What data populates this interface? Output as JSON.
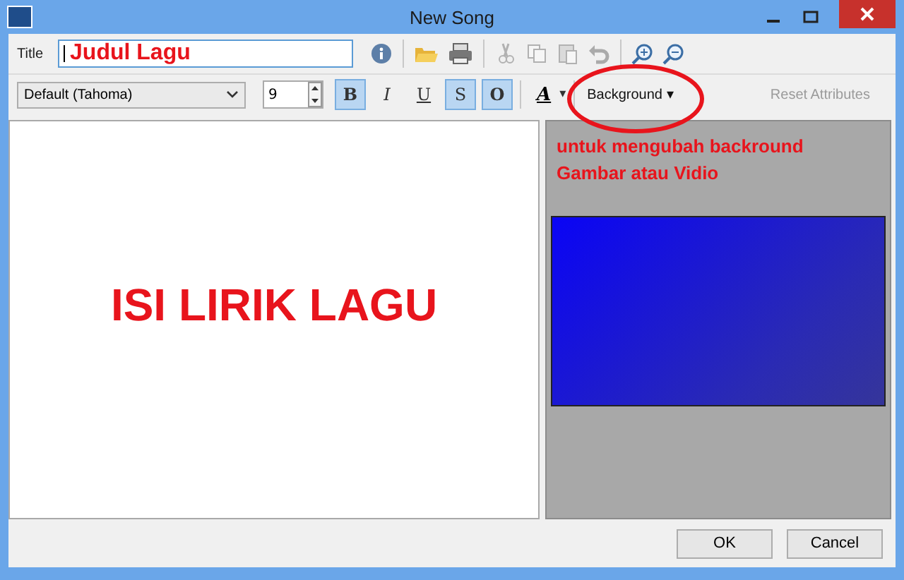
{
  "window": {
    "title": "New Song"
  },
  "title_field": {
    "label": "Title",
    "annotation": "Judul Lagu"
  },
  "toolbar": [
    {
      "kind": "info",
      "disabled": false
    },
    {
      "kind": "sep"
    },
    {
      "kind": "open",
      "disabled": false
    },
    {
      "kind": "print",
      "disabled": false
    },
    {
      "kind": "sep"
    },
    {
      "kind": "cut",
      "disabled": true
    },
    {
      "kind": "copy",
      "disabled": true
    },
    {
      "kind": "paste",
      "disabled": true
    },
    {
      "kind": "undo",
      "disabled": true
    },
    {
      "kind": "sep"
    },
    {
      "kind": "zoom-in",
      "disabled": false
    },
    {
      "kind": "zoom-out",
      "disabled": false
    }
  ],
  "format_bar": {
    "font": "Default (Tahoma)",
    "size": "9",
    "styles": [
      {
        "label": "B",
        "selected": true
      },
      {
        "label": "I",
        "selected": false
      },
      {
        "label": "U",
        "selected": false
      },
      {
        "label": "S",
        "selected": true
      },
      {
        "label": "O",
        "selected": true
      }
    ],
    "color_button": "A",
    "caret": "▾",
    "background": "Background",
    "reset": "Reset Attributes"
  },
  "editor": {
    "annotation": "ISI LIRIK LAGU"
  },
  "preview": {
    "annotation": "untuk mengubah backround Gambar atau Vidio"
  },
  "buttons": [
    "OK",
    "Cancel"
  ]
}
